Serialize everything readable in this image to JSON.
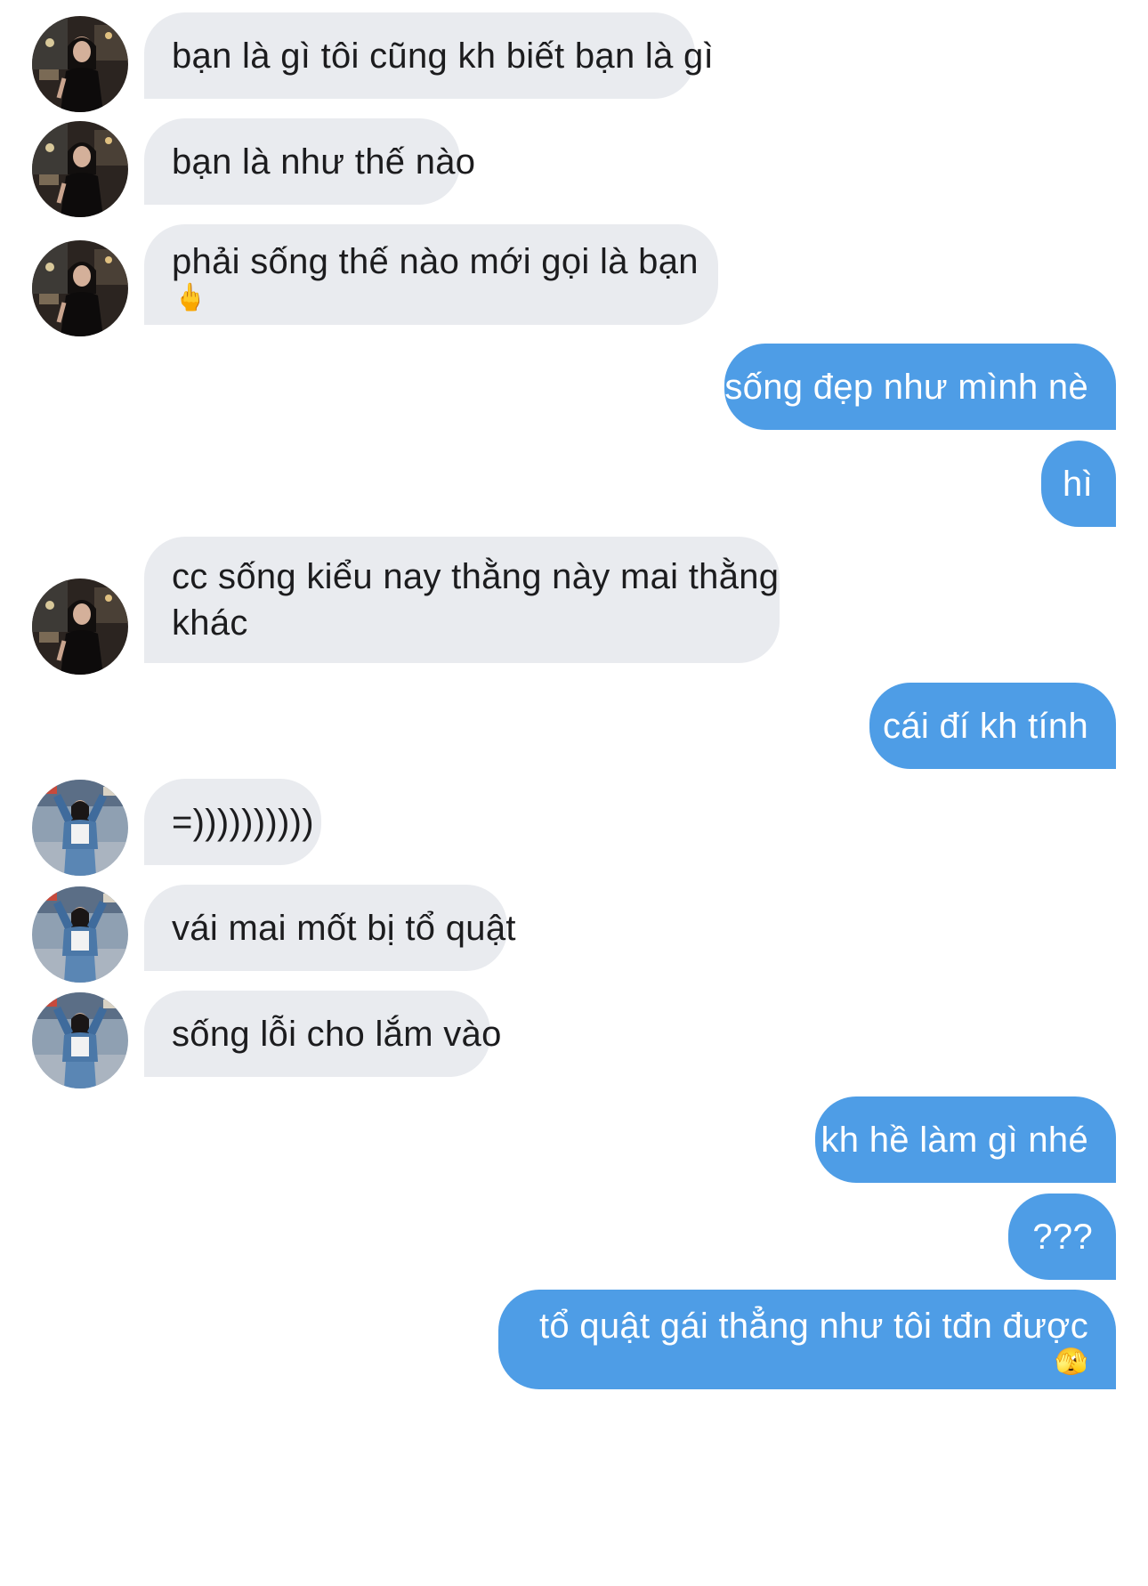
{
  "conversation": {
    "messages": [
      {
        "from": "them",
        "avatar": "avatar-night-photo",
        "text": "bạn là gì tôi cũng kh biết bạn là gì"
      },
      {
        "from": "them",
        "avatar": "avatar-night-photo",
        "text": "bạn là như thế nào"
      },
      {
        "from": "them",
        "avatar": "avatar-night-photo",
        "text": "phải sống thế nào mới gọi là bạn",
        "emoji": "🖕",
        "emoji_name": "middle-finger-emoji"
      },
      {
        "from": "me",
        "text": "sống đẹp như mình nè"
      },
      {
        "from": "me",
        "text": "hì"
      },
      {
        "from": "them",
        "avatar": "avatar-night-photo",
        "text": "cc sống kiểu nay thằng này mai thằng",
        "text2": "khác"
      },
      {
        "from": "me",
        "text": "cái đí kh tính"
      },
      {
        "from": "them",
        "avatar": "avatar-denim-photo",
        "text": "=))))))))))"
      },
      {
        "from": "them",
        "avatar": "avatar-denim-photo",
        "text": "vái mai mốt bị tổ quật"
      },
      {
        "from": "them",
        "avatar": "avatar-denim-photo",
        "text": "sống lỗi cho lắm vào"
      },
      {
        "from": "me",
        "text": "kh hề làm gì nhé"
      },
      {
        "from": "me",
        "text": "???"
      },
      {
        "from": "me",
        "text": "tổ quật gái thẳng như tôi tđn được",
        "emoji": "🫣",
        "emoji_name": "peeking-face-emoji"
      }
    ]
  },
  "colors": {
    "incoming_bubble": "#e9ebef",
    "outgoing_bubble": "#4e9de6",
    "incoming_text": "#1c1c1e",
    "outgoing_text": "#ffffff"
  }
}
